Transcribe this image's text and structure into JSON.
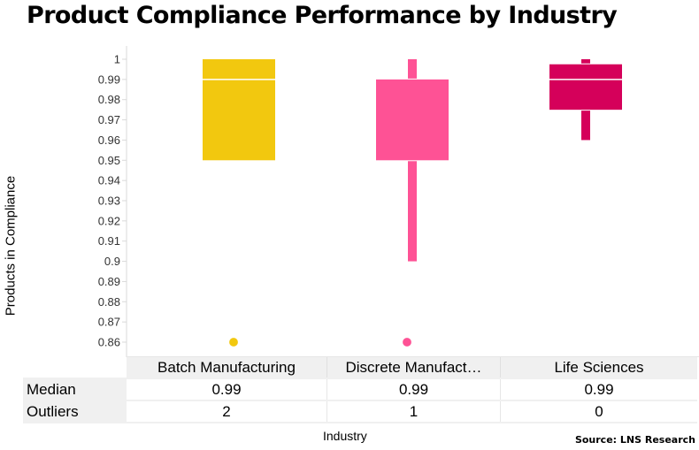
{
  "chart_data": {
    "type": "boxplot",
    "title": "Product Compliance Performance by Industry",
    "xlabel": "Industry",
    "ylabel": "Products in Compliance",
    "ylim": [
      0.85,
      1.0
    ],
    "yticks": [
      1,
      0.99,
      0.98,
      0.97,
      0.96,
      0.95,
      0.94,
      0.93,
      0.92,
      0.91,
      0.9,
      0.89,
      0.88,
      0.87,
      0.86
    ],
    "ytick_labels": [
      "1",
      "0.99",
      "0.98",
      "0.97",
      "0.96",
      "0.95",
      "0.94",
      "0.93",
      "0.92",
      "0.91",
      "0.9",
      "0.89",
      "0.88",
      "0.87",
      "0.86"
    ],
    "grid": false,
    "categories": [
      "Batch Manufacturing",
      "Discrete Manufact…",
      "Life Sciences"
    ],
    "series": [
      {
        "name": "Batch Manufacturing",
        "color": "#f2c80f",
        "whisker_low": 0.95,
        "q1": 0.95,
        "median": 0.99,
        "q3": 1.0,
        "whisker_high": 1.0,
        "outliers": [
          0.86
        ],
        "median_line": true
      },
      {
        "name": "Discrete Manufacturing",
        "color": "#fe5295",
        "whisker_low": 0.9,
        "q1": 0.95,
        "median": 0.99,
        "q3": 0.99,
        "whisker_high": 1.0,
        "outliers": [
          0.86
        ],
        "median_line": false
      },
      {
        "name": "Life Sciences",
        "color": "#d5005a",
        "whisker_low": 0.96,
        "q1": 0.975,
        "median": 0.99,
        "q3": 0.9975,
        "whisker_high": 1.0,
        "outliers": [],
        "median_line": true
      }
    ],
    "summary_table": {
      "row_labels": [
        "Median",
        "Outliers"
      ],
      "rows": [
        [
          "0.99",
          "0.99",
          "0.99"
        ],
        [
          "2",
          "1",
          "0"
        ]
      ]
    },
    "source": "Source: LNS Research"
  }
}
